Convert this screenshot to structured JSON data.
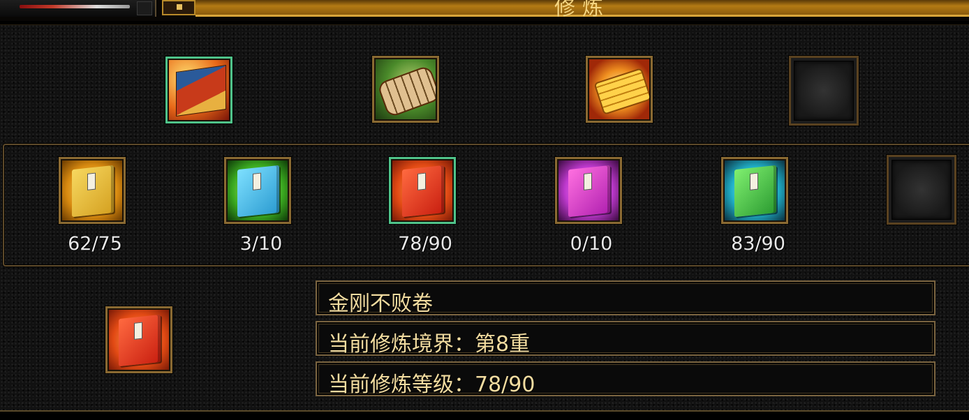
{
  "window": {
    "title": "修炼"
  },
  "top_row": {
    "items": [
      {
        "icon": "scripture-hall-icon",
        "selected": true
      },
      {
        "icon": "scroll-bundle-icon",
        "selected": false
      },
      {
        "icon": "gold-bars-icon",
        "selected": false
      },
      {
        "icon": "empty-slot",
        "selected": false
      }
    ]
  },
  "books": [
    {
      "icon": "gold-book-icon",
      "progress": "62/75",
      "selected": false
    },
    {
      "icon": "cyan-book-icon",
      "progress": "3/10",
      "selected": false
    },
    {
      "icon": "red-book-icon",
      "progress": "78/90",
      "selected": true
    },
    {
      "icon": "purple-book-icon",
      "progress": "0/10",
      "selected": false
    },
    {
      "icon": "green-book-icon",
      "progress": "83/90",
      "selected": false
    },
    {
      "icon": "empty-slot",
      "progress": "",
      "selected": false
    }
  ],
  "detail": {
    "icon": "red-book-icon",
    "name": "金刚不败卷",
    "realm": "当前修炼境界：第8重",
    "level": "当前修炼等级：78/90"
  },
  "colors": {
    "accent": "#d9a53a",
    "selected_border": "#4fc38a",
    "text": "#f2dca0"
  }
}
